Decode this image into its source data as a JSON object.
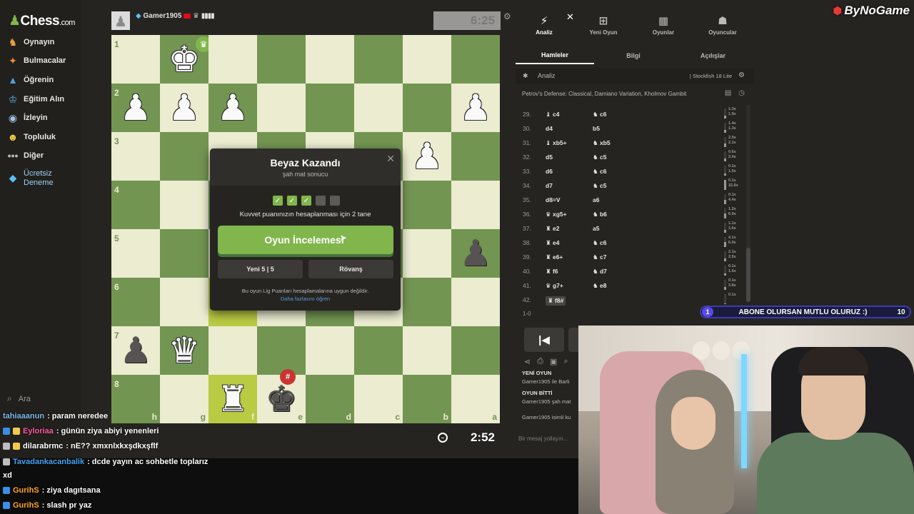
{
  "sidebar": {
    "logo_name": "Chess",
    "logo_suffix": ".com",
    "items": [
      {
        "label": "Oynayın",
        "icon": "play-icon"
      },
      {
        "label": "Bulmacalar",
        "icon": "puzzle-icon"
      },
      {
        "label": "Öğrenin",
        "icon": "learn-icon"
      },
      {
        "label": "Eğitim Alın",
        "icon": "coach-icon"
      },
      {
        "label": "İzleyin",
        "icon": "watch-icon"
      },
      {
        "label": "Topluluk",
        "icon": "community-icon"
      },
      {
        "label": "Diğer",
        "icon": "more-icon"
      },
      {
        "label": "Ücretsiz\nDeneme",
        "icon": "diamond-icon"
      }
    ],
    "search_label": "Ara"
  },
  "chat": [
    {
      "user": "tahiaaanun",
      "text": ": param neredee",
      "color": "#41a5f5"
    },
    {
      "user": "Eyloriaa",
      "text": ": günün ziya abiyi yenenleri",
      "color": "#ff5aa5"
    },
    {
      "user": "dilarabrmc",
      "text": ": nE?? xmxnlxkxşdkxşflf",
      "color": "#ffffff"
    },
    {
      "user": "Tavadankacanbalik",
      "text": ": dcde yayın ac sohbetle toplarız",
      "color": "#41a5f5"
    },
    {
      "user": "",
      "text": "xd",
      "color": "#ffffff"
    },
    {
      "user": "GurihS",
      "text": ": ziya dagıtsana",
      "color": "#ffa726"
    },
    {
      "user": "GurihS",
      "text": ": slash pr yaz",
      "color": "#ffa726"
    }
  ],
  "board": {
    "top_player": "Gamer1905",
    "top_clock": "6:25",
    "bottom_clock": "2:52",
    "ranks": [
      "1",
      "2",
      "3",
      "4",
      "5",
      "6",
      "7",
      "8"
    ],
    "files": [
      "h",
      "g",
      "f",
      "e",
      "d",
      "c",
      "b",
      "a"
    ],
    "win_badge": "♛",
    "mate_badge": "#"
  },
  "modal": {
    "title": "Beyaz Kazandı",
    "subtitle": "şah mat sonucu",
    "rating_note": "Kuvvet puanınızın hesaplanması için 2 tane",
    "review_button": "Oyun İncelemesi",
    "new_game_button": "Yeni 5 | 5",
    "rematch_button": "Rövanş",
    "league_note": "Bu oyun Lig Puanları hesaplamalarına uygun değildir.",
    "learn_more": "Daha fazlasını öğren",
    "checks_done": 3,
    "checks_total": 5
  },
  "panel": {
    "tools": [
      {
        "label": "Analiz",
        "icon": "analysis-icon"
      },
      {
        "label": "Yeni Oyun",
        "icon": "new-game-icon"
      },
      {
        "label": "Oyunlar",
        "icon": "games-icon"
      },
      {
        "label": "Oyuncular",
        "icon": "players-icon"
      }
    ],
    "tabs": [
      "Hamleler",
      "Bilgi",
      "Açılışlar"
    ],
    "analysis_label": "Analiz",
    "engine": "Stockfish 18 Lite",
    "opening": "Petrov's Defense: Classical, Damiano Variation, Kholmov Gambit",
    "moves": [
      {
        "n": "29.",
        "w": "♝ c4",
        "b": "♞ c6",
        "tw": "1.3s",
        "tb": "1.9s",
        "bar": 0.3
      },
      {
        "n": "30.",
        "w": "d4",
        "b": "b5",
        "tw": "1.4s",
        "tb": "1.3s",
        "bar": 0.3
      },
      {
        "n": "31.",
        "w": "♝ xb5+",
        "b": "♞ xb5",
        "tw": "2.0s",
        "tb": "2.1s",
        "bar": 0.35
      },
      {
        "n": "32.",
        "w": "d5",
        "b": "♞ c5",
        "tw": "0.6s",
        "tb": "2.4s",
        "bar": 0.3
      },
      {
        "n": "33.",
        "w": "d6",
        "b": "♞ c6",
        "tw": "0.1s",
        "tb": "1.5s",
        "bar": 0.2
      },
      {
        "n": "34.",
        "w": "d7",
        "b": "♞ c5",
        "tw": "0.1s",
        "tb": "15.8s",
        "bar": 1.0
      },
      {
        "n": "35.",
        "w": "d8=V",
        "b": "a6",
        "tw": "0.1s",
        "tb": "4.4s",
        "bar": 0.4
      },
      {
        "n": "36.",
        "w": "♛ xg5+",
        "b": "♞ b6",
        "tw": "1.2s",
        "tb": "6.9s",
        "bar": 0.5
      },
      {
        "n": "37.",
        "w": "♜ e2",
        "b": "a5",
        "tw": "1.1s",
        "tb": "1.6s",
        "bar": 0.3
      },
      {
        "n": "38.",
        "w": "♜ e4",
        "b": "♞ c6",
        "tw": "4.1s",
        "tb": "6.0s",
        "bar": 0.5
      },
      {
        "n": "39.",
        "w": "♜ e6+",
        "b": "♞ c7",
        "tw": "2.1s",
        "tb": "2.5s",
        "bar": 0.3
      },
      {
        "n": "40.",
        "w": "♜ f6",
        "b": "♞ d7",
        "tw": "0.1s",
        "tb": "1.5s",
        "bar": 0.2
      },
      {
        "n": "41.",
        "w": "♛ g7+",
        "b": "♞ e8",
        "tw": "0.1s",
        "tb": "3.8s",
        "bar": 0.3
      },
      {
        "n": "42.",
        "w": "♜ f8#",
        "b": "",
        "tw": "0.1s",
        "tb": "",
        "bar": 0.1
      }
    ],
    "result": "1-0",
    "log_header1": "YENİ OYUN",
    "log_line1": "Gamer1905 ile Barli",
    "log_header2": "OYUN BİTTİ",
    "log_line2": "Gamer1905 şah mat",
    "log_line3": "Gamer1905 isimli ku",
    "message_placeholder": "Bir mesaj yollayın..."
  },
  "overlay": {
    "brand": "ByNoGame",
    "banner_num": "1",
    "banner_text": "ABONE OLURSAN MUTLU OLURUZ :)",
    "banner_count": "10"
  },
  "colors": {
    "board_light": "#ebecd0",
    "board_dark": "#739552",
    "accent_green": "#81b64c",
    "mate_red": "#ca3431"
  }
}
